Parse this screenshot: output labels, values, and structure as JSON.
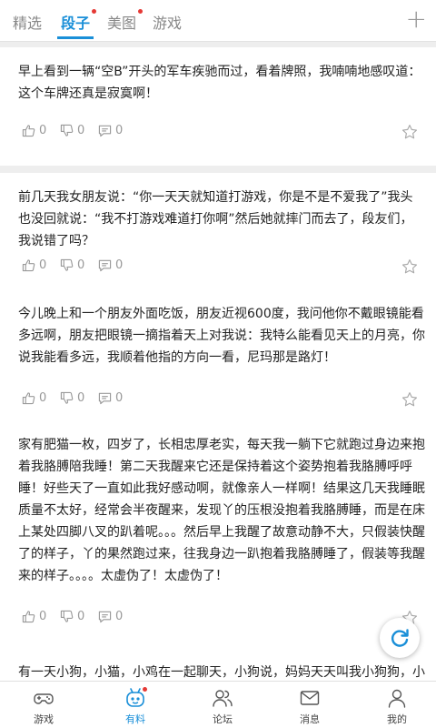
{
  "top_tabs": {
    "items": [
      {
        "label": "精选",
        "active": false,
        "dot": false
      },
      {
        "label": "段子",
        "active": true,
        "dot": true
      },
      {
        "label": "美图",
        "active": false,
        "dot": true
      },
      {
        "label": "游戏",
        "active": false,
        "dot": false
      }
    ],
    "add_icon": "plus-icon"
  },
  "posts": [
    {
      "text": "早上看到一辆“空B”开头的军车疾驰而过，看着牌照，我喃喃地感叹道：这个车牌还真是寂寞啊！",
      "likes": "0",
      "dislikes": "0",
      "comments": "0"
    },
    {
      "text": "前几天我女朋友说：“你一天天就知道打游戏，你是不是不爱我了”我头也没回就说：“我不打游戏难道打你啊”然后她就摔门而去了，段友们，我说错了吗？",
      "likes": "0",
      "dislikes": "0",
      "comments": "0"
    },
    {
      "text": "今儿晚上和一个朋友外面吃饭，朋友近视600度，我问他你不戴眼镜能看多远啊，朋友把眼镜一摘指着天上对我说：我特么能看见天上的月亮，你说我能看多远，我顺着他指的方向一看，尼玛那是路灯！",
      "likes": "0",
      "dislikes": "0",
      "comments": "0"
    },
    {
      "text": "家有肥猫一枚，四岁了，长相忠厚老实，每天我一躺下它就跑过身边来抱着我胳膊陪我睡！第二天我醒来它还是保持着这个姿势抱着我胳膊呼呼睡！好些天了一直如此我好感动啊，就像亲人一样啊！结果这几天我睡眠质量不太好，经常会半夜醒来，发现丫的压根没抱着我胳膊睡，而是在床上某处四脚八叉的趴着呢。。。然后早上我醒了故意动静不大，只假装快醒了的样子，丫的果然跑过来，往我身边一趴抱着我胳膊睡了，假装等我醒来的样子。。。。太虚伪了！太虚伪了！",
      "likes": "0",
      "dislikes": "0",
      "comments": "0"
    },
    {
      "text": "有一天小狗，小猫，小鸡在一起聊天，小狗说，妈妈天天叫我小狗狗，小",
      "likes": "",
      "dislikes": "",
      "comments": ""
    }
  ],
  "bottom_nav": [
    {
      "label": "游戏",
      "icon": "gamepad-icon",
      "active": false
    },
    {
      "label": "有料",
      "icon": "mascot-icon",
      "active": true
    },
    {
      "label": "论坛",
      "icon": "forum-users-icon",
      "active": false
    },
    {
      "label": "消息",
      "icon": "envelope-icon",
      "active": false
    },
    {
      "label": "我的",
      "icon": "person-icon",
      "active": false
    }
  ],
  "colors": {
    "accent": "#1a8fd8",
    "badge": "#e53935"
  }
}
